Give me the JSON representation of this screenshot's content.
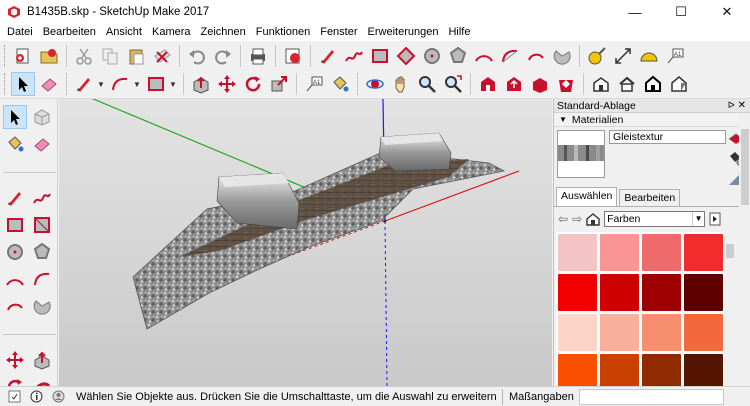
{
  "window": {
    "title": "B1435B.skp - SketchUp Make 2017",
    "minimize": "—",
    "maximize": "☐",
    "close": "✕"
  },
  "menu": [
    "Datei",
    "Bearbeiten",
    "Ansicht",
    "Kamera",
    "Zeichnen",
    "Funktionen",
    "Fenster",
    "Erweiterungen",
    "Hilfe"
  ],
  "tray": {
    "title": "Standard-Ablage",
    "pin": "ᐅ",
    "close": "✕",
    "materials": {
      "header": "Materialien",
      "current_name": "Gleistextur",
      "tabs": [
        "Auswählen",
        "Bearbeiten"
      ],
      "active_tab": "Auswählen",
      "library": "Farben",
      "swatches": [
        "#f4c4c4",
        "#f99595",
        "#ef6b6b",
        "#f22c2c",
        "#f20000",
        "#cf0000",
        "#9c0000",
        "#5d0000",
        "#fcd4c8",
        "#f9b09a",
        "#f78e6e",
        "#f4683d",
        "#f95000",
        "#c94000",
        "#902a00",
        "#541600"
      ]
    }
  },
  "status": {
    "message": "Wählen Sie Objekte aus. Drücken Sie die Umschalttaste, um die Auswahl zu erweitern. Zi...",
    "measure_label": "Maßangaben"
  },
  "colors": {
    "accent_red": "#c8102e",
    "selected_tool": "#cce4f7"
  }
}
